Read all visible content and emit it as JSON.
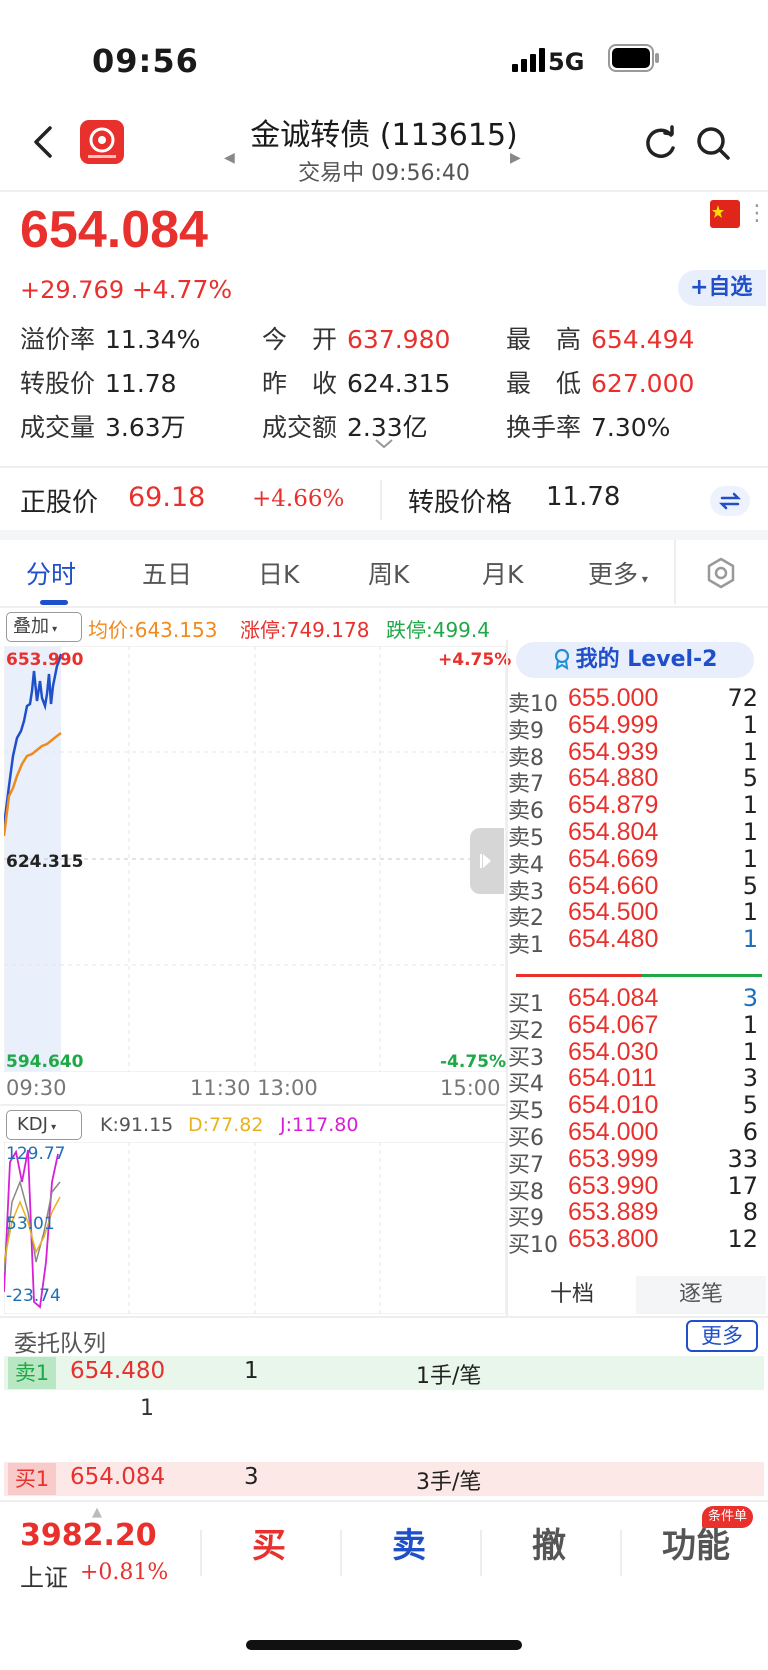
{
  "status_bar": {
    "time": "09:56",
    "network": "5G"
  },
  "nav": {
    "title": "金诚转债 (113615)",
    "subtitle": "交易中 09:56:40"
  },
  "quote": {
    "price": "654.084",
    "change": "+29.769",
    "change_pct": "+4.77%",
    "watch_label": "+自选"
  },
  "stats": [
    {
      "label": "溢价率",
      "value": "11.34%",
      "color": "#222"
    },
    {
      "label": "今　开",
      "value": "637.980",
      "color": "#e8302c"
    },
    {
      "label": "最　高",
      "value": "654.494",
      "color": "#e8302c"
    },
    {
      "label": "转股价",
      "value": "11.78",
      "color": "#222"
    },
    {
      "label": "昨　收",
      "value": "624.315",
      "color": "#222"
    },
    {
      "label": "最　低",
      "value": "627.000",
      "color": "#e8302c"
    },
    {
      "label": "成交量",
      "value": "3.63万",
      "color": "#222"
    },
    {
      "label": "成交额",
      "value": "2.33亿",
      "color": "#222"
    },
    {
      "label": "换手率",
      "value": "7.30%",
      "color": "#222"
    }
  ],
  "stock_bar": {
    "label": "正股价",
    "price": "69.18",
    "pct": "+4.66%",
    "conv_label": "转股价格",
    "conv_value": "11.78"
  },
  "tabs": [
    "分时",
    "五日",
    "日K",
    "周K",
    "月K",
    "更多"
  ],
  "overlay": {
    "button": "叠加",
    "avg": "均价:643.153",
    "limit_up": "涨停:749.178",
    "limit_down": "跌停:499.4"
  },
  "chart": {
    "top_price": "653.990",
    "top_pct": "+4.75%",
    "mid_price": "624.315",
    "bottom_price": "594.640",
    "bottom_pct": "-4.75%",
    "x_labels": [
      "09:30",
      "11:30 13:00",
      "15:00"
    ]
  },
  "kdj": {
    "button": "KDJ",
    "k": "K:91.15",
    "d": "D:77.82",
    "j": "J:117.80",
    "top": "129.77",
    "mid": "53.01",
    "bottom": "-23.74"
  },
  "level2": {
    "title": "我的 Level-2",
    "tab1": "十档",
    "tab2": "逐笔"
  },
  "asks": [
    {
      "label": "卖10",
      "price": "655.000",
      "qty": "72"
    },
    {
      "label": "卖9",
      "price": "654.999",
      "qty": "1"
    },
    {
      "label": "卖8",
      "price": "654.939",
      "qty": "1"
    },
    {
      "label": "卖7",
      "price": "654.880",
      "qty": "5"
    },
    {
      "label": "卖6",
      "price": "654.879",
      "qty": "1"
    },
    {
      "label": "卖5",
      "price": "654.804",
      "qty": "1"
    },
    {
      "label": "卖4",
      "price": "654.669",
      "qty": "1"
    },
    {
      "label": "卖3",
      "price": "654.660",
      "qty": "5"
    },
    {
      "label": "卖2",
      "price": "654.500",
      "qty": "1"
    },
    {
      "label": "卖1",
      "price": "654.480",
      "qty": "1"
    }
  ],
  "bids": [
    {
      "label": "买1",
      "price": "654.084",
      "qty": "3"
    },
    {
      "label": "买2",
      "price": "654.067",
      "qty": "1"
    },
    {
      "label": "买3",
      "price": "654.030",
      "qty": "1"
    },
    {
      "label": "买4",
      "price": "654.011",
      "qty": "3"
    },
    {
      "label": "买5",
      "price": "654.010",
      "qty": "5"
    },
    {
      "label": "买6",
      "price": "654.000",
      "qty": "6"
    },
    {
      "label": "买7",
      "price": "653.999",
      "qty": "33"
    },
    {
      "label": "买8",
      "price": "653.990",
      "qty": "17"
    },
    {
      "label": "买9",
      "price": "653.889",
      "qty": "8"
    },
    {
      "label": "买10",
      "price": "653.800",
      "qty": "12"
    }
  ],
  "queue": {
    "title": "委托队列",
    "more": "更多",
    "sell": {
      "label": "卖1",
      "price": "654.480",
      "count": "1",
      "per": "1手/笔",
      "order": "1"
    },
    "buy": {
      "label": "买1",
      "price": "654.084",
      "count": "3",
      "per": "3手/笔"
    }
  },
  "bottom": {
    "index_value": "3982.20",
    "index_name": "上证",
    "index_pct": "+0.81%",
    "buy": "买",
    "sell": "卖",
    "cancel": "撤",
    "func": "功能",
    "func_badge": "条件单"
  }
}
